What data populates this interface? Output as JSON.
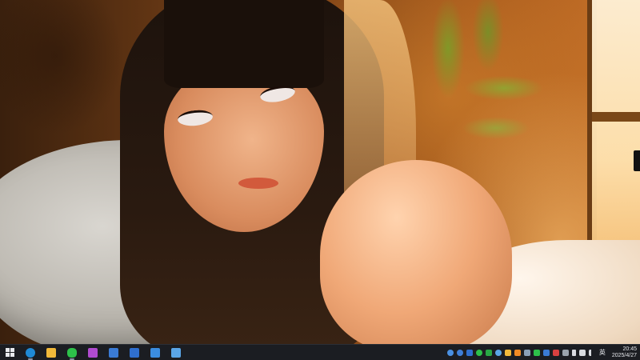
{
  "wallpaper": {
    "description_icon": "anime-wallpaper"
  },
  "taskbar": {
    "pinned_apps": [
      {
        "name": "start-button",
        "icon": "windows-icon",
        "color": "#e8eaee",
        "running": false
      },
      {
        "name": "edge-button",
        "icon": "edge-icon",
        "color": "#1f8ad6",
        "running": true
      },
      {
        "name": "file-explorer-button",
        "icon": "folder-icon",
        "color": "#f1b93a",
        "running": false
      },
      {
        "name": "wechat-button",
        "icon": "wechat-icon",
        "color": "#2dc14a",
        "running": true
      },
      {
        "name": "app-purple-button",
        "icon": "purple-app-icon",
        "color": "#b04bd0",
        "running": false
      },
      {
        "name": "app-blue-cloud-button",
        "icon": "cloud-app-icon",
        "color": "#3a7bd5",
        "running": false
      },
      {
        "name": "app-blue-box-button",
        "icon": "blue-box-icon",
        "color": "#2f6fcf",
        "running": false
      },
      {
        "name": "app-network-button",
        "icon": "network-app-icon",
        "color": "#3b8de0",
        "running": false
      },
      {
        "name": "photos-button",
        "icon": "image-icon",
        "color": "#5aa6e8",
        "running": false
      }
    ],
    "tray": {
      "icons": [
        {
          "name": "tray-app-1",
          "icon": "blue-circle-icon",
          "color": "#4a90e2"
        },
        {
          "name": "tray-app-2",
          "icon": "blue-circle-icon",
          "color": "#3f7fd8"
        },
        {
          "name": "tray-app-3",
          "icon": "blue-square-icon",
          "color": "#2f6fcf"
        },
        {
          "name": "tray-app-4",
          "icon": "green-circle-icon",
          "color": "#2dc14a"
        },
        {
          "name": "tray-app-5",
          "icon": "green-square-icon",
          "color": "#28a745"
        },
        {
          "name": "tray-app-6",
          "icon": "blue-circle-icon",
          "color": "#5aa6e8"
        },
        {
          "name": "tray-app-7",
          "icon": "yellow-square-icon",
          "color": "#f1b93a"
        },
        {
          "name": "tray-app-8",
          "icon": "orange-square-icon",
          "color": "#f08a24"
        },
        {
          "name": "tray-app-9",
          "icon": "monitor-icon",
          "color": "#8aa0b8"
        },
        {
          "name": "tray-app-10",
          "icon": "wechat-icon",
          "color": "#2dc14a"
        },
        {
          "name": "tray-app-11",
          "icon": "blue-square-icon",
          "color": "#3a7bd5"
        },
        {
          "name": "tray-app-12",
          "icon": "red-square-icon",
          "color": "#d94040"
        },
        {
          "name": "tray-app-13",
          "icon": "gray-square-icon",
          "color": "#9aa3ad"
        },
        {
          "name": "battery-icon",
          "icon": "battery-icon",
          "color": "#d8dbe0"
        },
        {
          "name": "network-icon",
          "icon": "monitor-icon",
          "color": "#d8dbe0"
        },
        {
          "name": "volume-icon",
          "icon": "speaker-icon",
          "color": "#d8dbe0"
        }
      ],
      "ime_label": "英",
      "time": "20:45",
      "date": "2025/4/27"
    }
  }
}
